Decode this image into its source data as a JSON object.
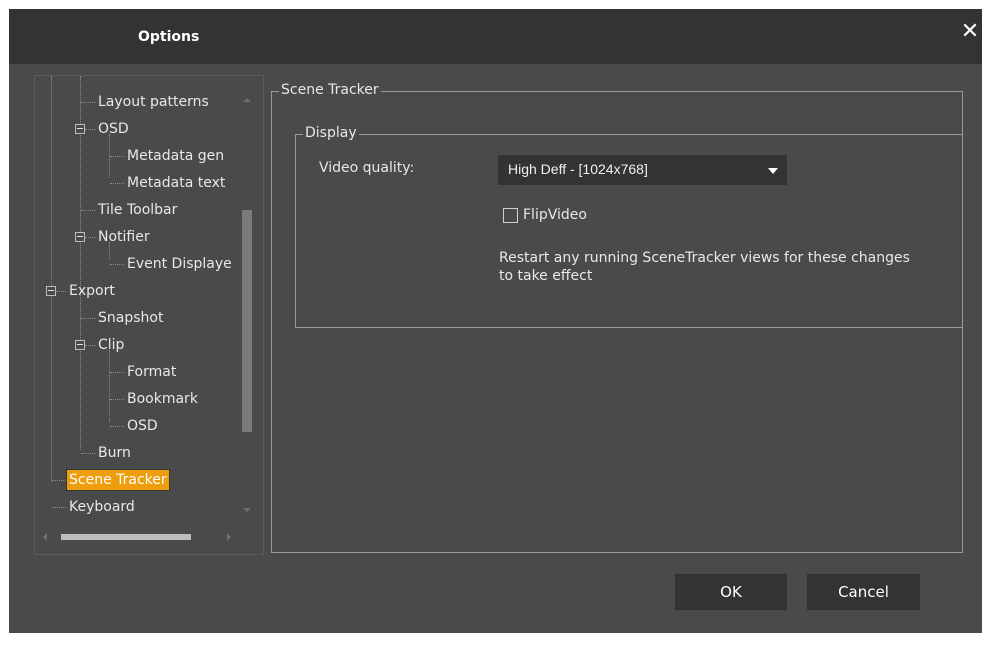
{
  "dialog": {
    "title": "Options",
    "close_glyph": "✕"
  },
  "tree": {
    "items": [
      {
        "label": "Layout patterns",
        "level": 2,
        "expander": false
      },
      {
        "label": "OSD",
        "level": 2,
        "expander": true
      },
      {
        "label": "Metadata gen",
        "level": 3,
        "expander": false
      },
      {
        "label": "Metadata text",
        "level": 3,
        "expander": false
      },
      {
        "label": "Tile Toolbar",
        "level": 2,
        "expander": false
      },
      {
        "label": "Notifier",
        "level": 2,
        "expander": true
      },
      {
        "label": "Event Displaye",
        "level": 3,
        "expander": false
      },
      {
        "label": "Export",
        "level": 1,
        "expander": true
      },
      {
        "label": "Snapshot",
        "level": 2,
        "expander": false
      },
      {
        "label": "Clip",
        "level": 2,
        "expander": true
      },
      {
        "label": "Format",
        "level": 3,
        "expander": false
      },
      {
        "label": "Bookmark",
        "level": 3,
        "expander": false
      },
      {
        "label": "OSD",
        "level": 3,
        "expander": false
      },
      {
        "label": "Burn",
        "level": 2,
        "expander": false
      },
      {
        "label": "Scene Tracker",
        "level": 1,
        "expander": false,
        "selected": true
      },
      {
        "label": "Keyboard",
        "level": 1,
        "expander": false
      }
    ]
  },
  "scene_tracker": {
    "group_label": "Scene Tracker",
    "display_group_label": "Display",
    "video_quality_label": "Video quality:",
    "video_quality_value": "High Deff - [1024x768]",
    "flip_video_label": "FlipVideo",
    "flip_video_checked": false,
    "restart_note": "Restart any running SceneTracker views for these changes to take effect"
  },
  "buttons": {
    "ok": "OK",
    "cancel": "Cancel"
  },
  "colors": {
    "selection": "#ee9d0d",
    "dialog_bg": "#4a4a4a",
    "titlebar_bg": "#333333",
    "button_bg": "#333333"
  }
}
